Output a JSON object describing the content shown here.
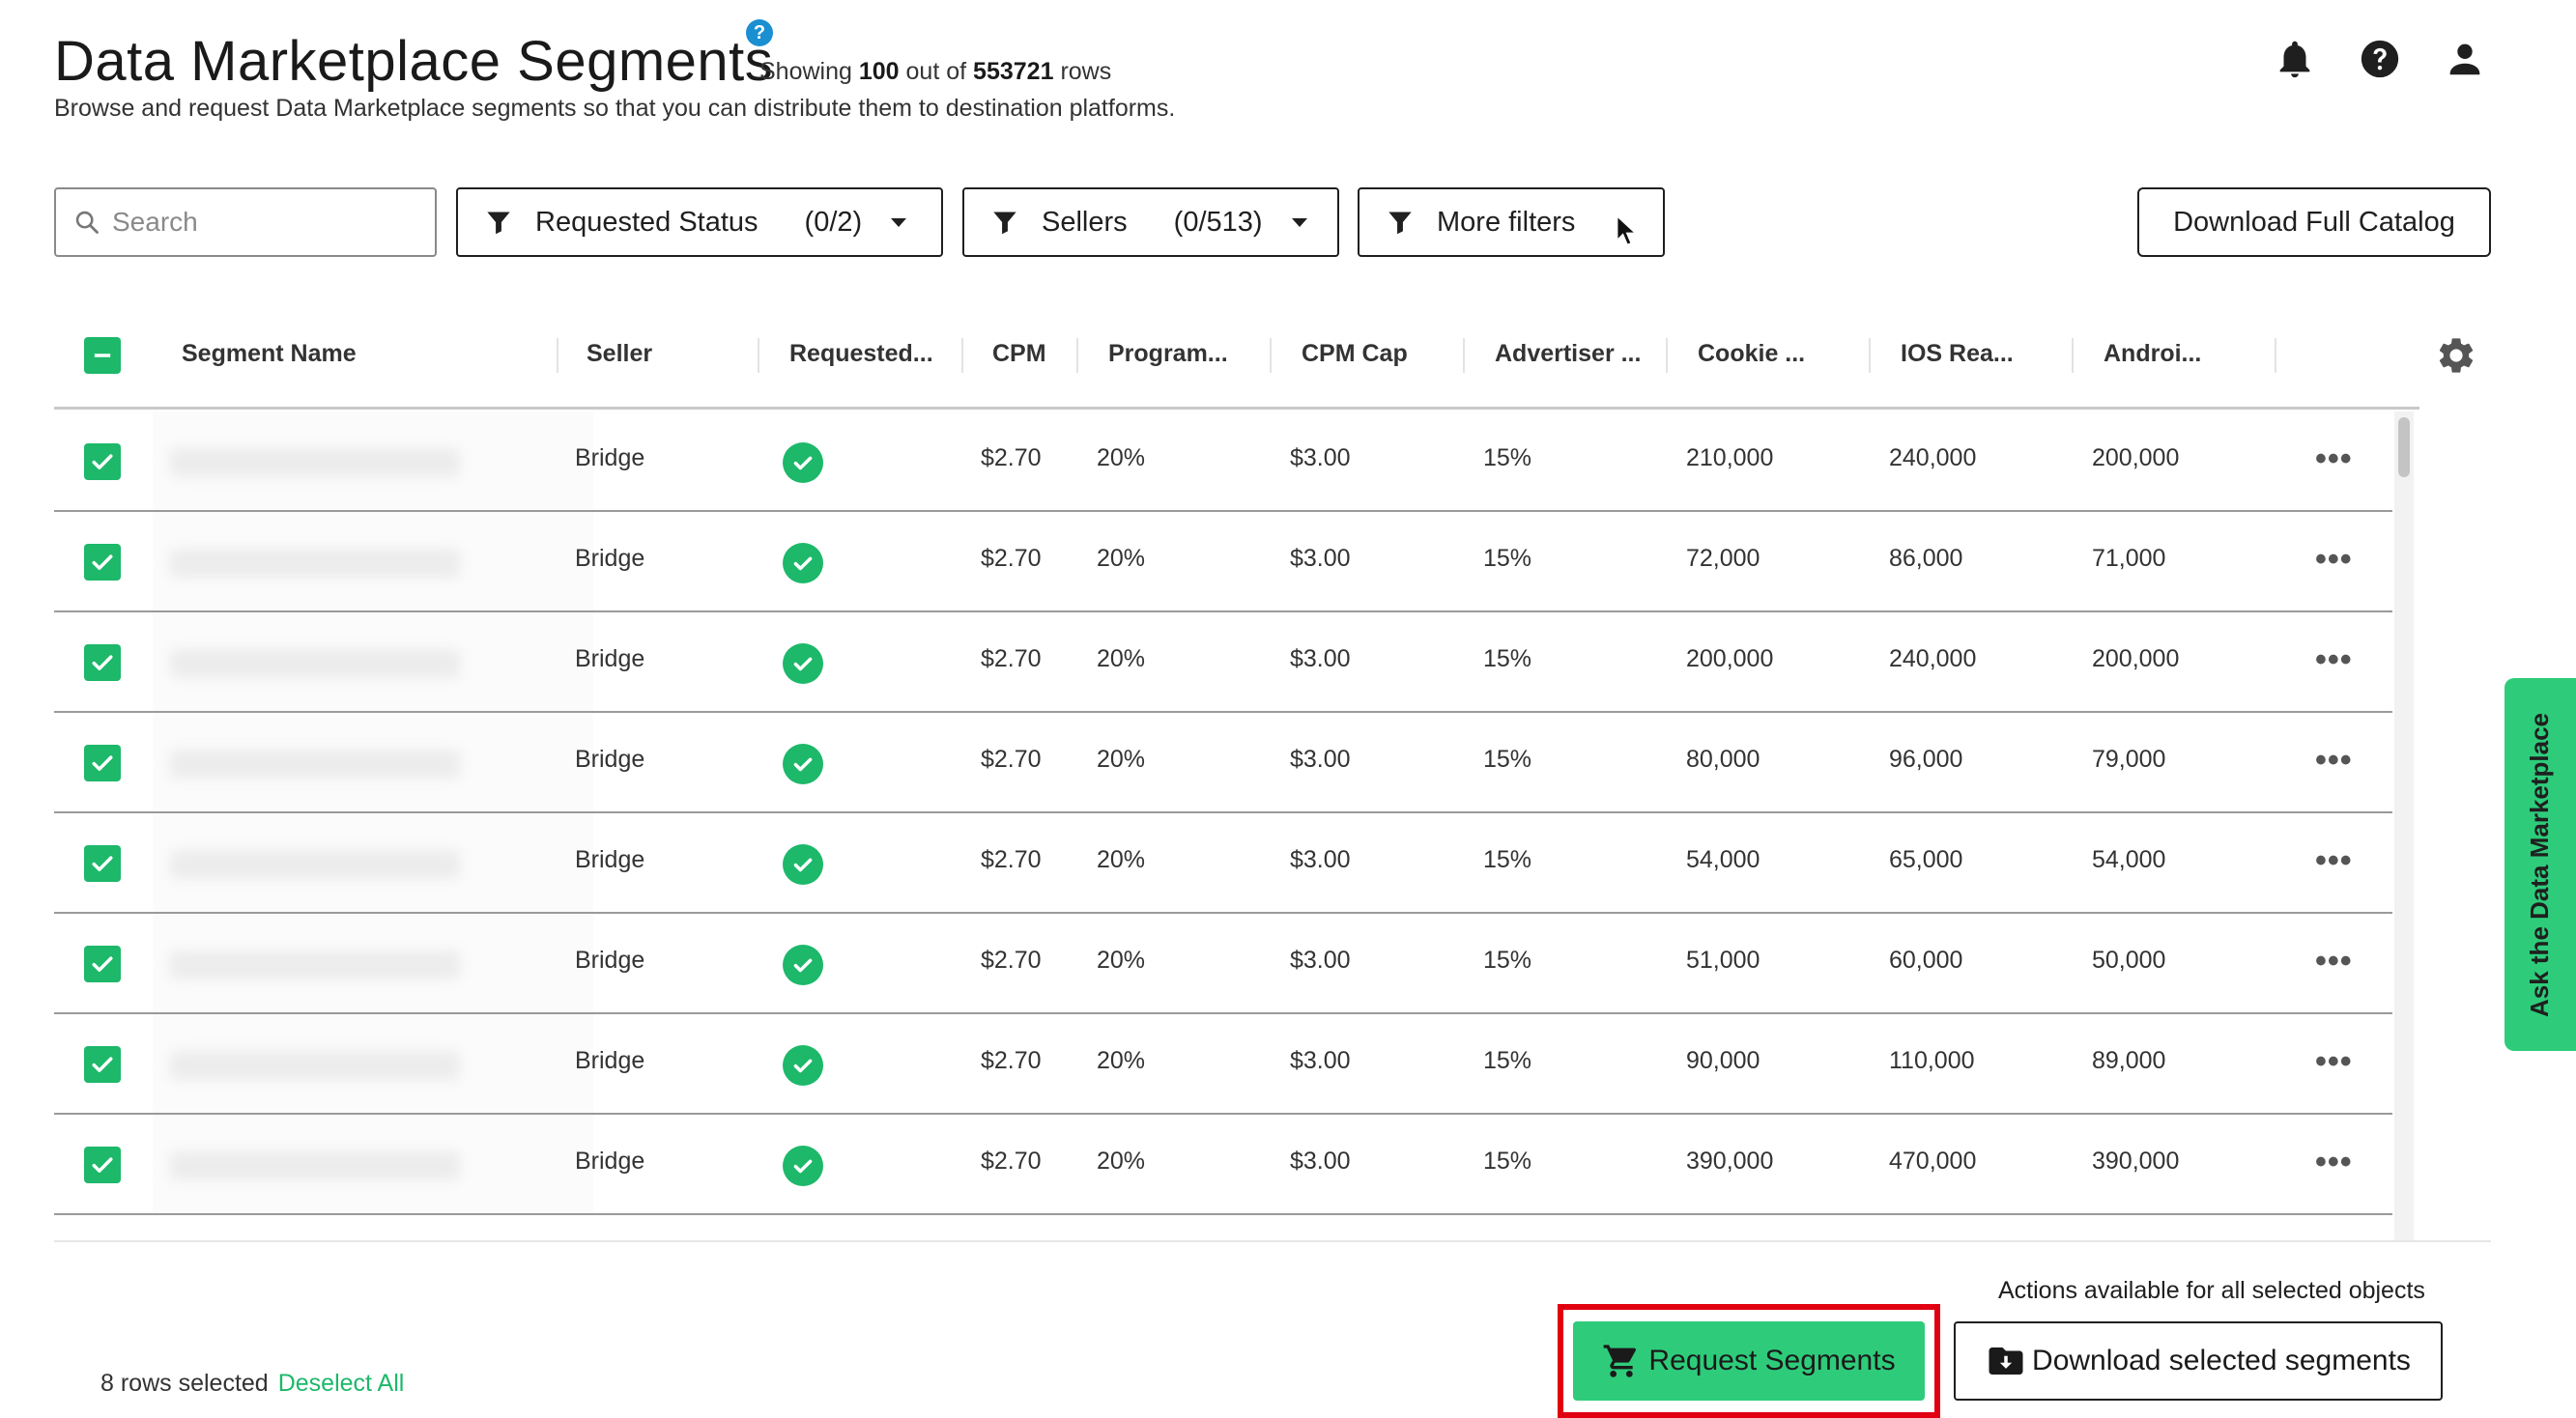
{
  "header": {
    "title": "Data Marketplace Segments",
    "info_badge": "?",
    "showing_prefix": "Showing",
    "showing_count": "100",
    "showing_mid": "out of",
    "showing_total": "553721",
    "showing_suffix": "rows",
    "subtitle": "Browse and request Data Marketplace segments so that you can distribute them to destination platforms.",
    "icons": [
      "bell-icon",
      "help-icon",
      "user-icon"
    ]
  },
  "filters": {
    "search_placeholder": "Search",
    "requested_status_label": "Requested Status",
    "requested_status_count": "(0/2)",
    "sellers_label": "Sellers",
    "sellers_count": "(0/513)",
    "more_filters_label": "More filters",
    "download_catalog_label": "Download Full Catalog"
  },
  "table": {
    "columns": [
      "Segment Name",
      "Seller",
      "Requested...",
      "CPM",
      "Program...",
      "CPM Cap",
      "Advertiser ...",
      "Cookie ...",
      "IOS Rea...",
      "Androi..."
    ],
    "rows": [
      {
        "seller": "Bridge",
        "cpm": "$2.70",
        "program": "20%",
        "cpm_cap": "$3.00",
        "advertiser": "15%",
        "cookie": "210,000",
        "ios": "240,000",
        "android": "200,000"
      },
      {
        "seller": "Bridge",
        "cpm": "$2.70",
        "program": "20%",
        "cpm_cap": "$3.00",
        "advertiser": "15%",
        "cookie": "72,000",
        "ios": "86,000",
        "android": "71,000"
      },
      {
        "seller": "Bridge",
        "cpm": "$2.70",
        "program": "20%",
        "cpm_cap": "$3.00",
        "advertiser": "15%",
        "cookie": "200,000",
        "ios": "240,000",
        "android": "200,000"
      },
      {
        "seller": "Bridge",
        "cpm": "$2.70",
        "program": "20%",
        "cpm_cap": "$3.00",
        "advertiser": "15%",
        "cookie": "80,000",
        "ios": "96,000",
        "android": "79,000"
      },
      {
        "seller": "Bridge",
        "cpm": "$2.70",
        "program": "20%",
        "cpm_cap": "$3.00",
        "advertiser": "15%",
        "cookie": "54,000",
        "ios": "65,000",
        "android": "54,000"
      },
      {
        "seller": "Bridge",
        "cpm": "$2.70",
        "program": "20%",
        "cpm_cap": "$3.00",
        "advertiser": "15%",
        "cookie": "51,000",
        "ios": "60,000",
        "android": "50,000"
      },
      {
        "seller": "Bridge",
        "cpm": "$2.70",
        "program": "20%",
        "cpm_cap": "$3.00",
        "advertiser": "15%",
        "cookie": "90,000",
        "ios": "110,000",
        "android": "89,000"
      },
      {
        "seller": "Bridge",
        "cpm": "$2.70",
        "program": "20%",
        "cpm_cap": "$3.00",
        "advertiser": "15%",
        "cookie": "390,000",
        "ios": "470,000",
        "android": "390,000"
      }
    ],
    "row_menu": "•••"
  },
  "footer": {
    "selected_text": "8 rows selected",
    "deselect_label": "Deselect All",
    "actions_label": "Actions available for all selected objects",
    "request_label": "Request Segments",
    "download_selected_label": "Download selected segments"
  },
  "side_tab": {
    "label": "Ask the Data Marketplace"
  },
  "colors": {
    "accent": "#2ecc7a",
    "check": "#1db86a",
    "highlight": "#e00012",
    "info": "#1a8fd1"
  }
}
